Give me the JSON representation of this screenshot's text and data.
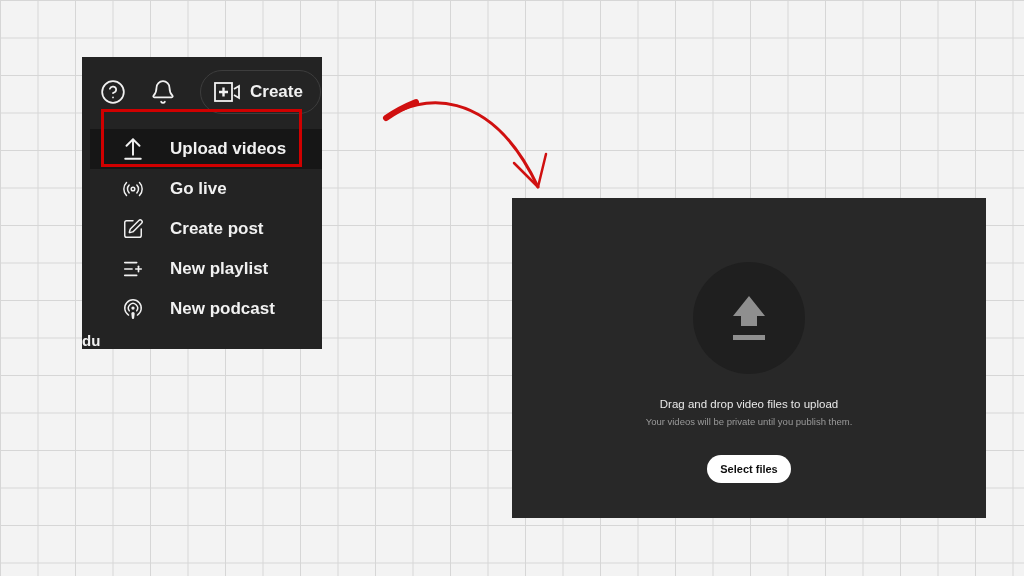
{
  "header": {
    "create_button": {
      "label": "Create"
    }
  },
  "menu": {
    "items": [
      {
        "kind": "upload",
        "label": "Upload videos",
        "selected": true
      },
      {
        "kind": "live",
        "label": "Go live",
        "selected": false
      },
      {
        "kind": "post",
        "label": "Create post",
        "selected": false
      },
      {
        "kind": "playlist",
        "label": "New playlist",
        "selected": false
      },
      {
        "kind": "podcast",
        "label": "New podcast",
        "selected": false
      }
    ]
  },
  "fragment_text": "du",
  "upload_dialog": {
    "heading": "Drag and drop video files to upload",
    "note": "Your videos will be private until you publish them.",
    "button": "Select files"
  }
}
